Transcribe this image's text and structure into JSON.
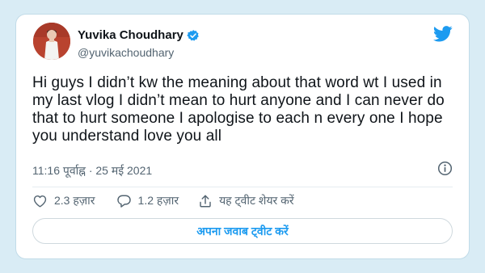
{
  "tweet": {
    "author_name": "Yuvika Choudhary",
    "handle": "@yuvikachoudhary",
    "text": "Hi guys I didn’t kw the meaning about that word  wt I used in my last vlog I didn’t mean to hurt anyone and I can never do that to hurt  someone  I apologise to each n every one I hope you understand love you all",
    "timestamp": "11:16 पूर्वाह्न · 25 मई 2021"
  },
  "actions": {
    "likes": "2.3 हज़ार",
    "replies": "1.2 हज़ार",
    "share_label": "यह ट्वीट शेयर करें"
  },
  "reply_button_label": "अपना जवाब ट्वीट करें",
  "icons": {
    "verified": "verified-badge-icon",
    "brand": "twitter-bird-icon",
    "info": "info-icon",
    "like": "heart-icon",
    "reply": "speech-bubble-icon",
    "share": "share-icon"
  },
  "colors": {
    "background": "#d9ecf5",
    "accent": "#1d9bf0",
    "text": "#0f1419",
    "secondary_text": "#536471"
  }
}
